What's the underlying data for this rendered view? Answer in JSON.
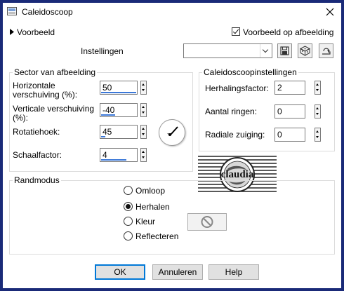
{
  "window": {
    "title": "Caleidoscoop"
  },
  "preview": {
    "label": "Voorbeeld",
    "checkbox_label": "Voorbeeld op afbeelding",
    "checked": true
  },
  "settings": {
    "label": "Instellingen",
    "value": ""
  },
  "sector": {
    "group_title": "Sector van afbeelding",
    "h_shift_label": "Horizontale verschuiving (%):",
    "h_shift_value": "50",
    "v_shift_label": "Verticale verschuiving (%):",
    "v_shift_value": "-40",
    "rotation_label": "Rotatiehoek:",
    "rotation_value": "45",
    "scale_label": "Schaalfactor:",
    "scale_value": "4"
  },
  "kaleido": {
    "group_title": "Caleidoscoopinstellingen",
    "repeat_label": "Herhalingsfactor:",
    "repeat_value": "2",
    "rings_label": "Aantal ringen:",
    "rings_value": "0",
    "radial_label": "Radiale zuiging:",
    "radial_value": "0"
  },
  "edge": {
    "group_title": "Randmodus",
    "options": [
      "Omloop",
      "Herhalen",
      "Kleur",
      "Reflecteren"
    ],
    "selected": "Herhalen"
  },
  "buttons": {
    "ok": "OK",
    "cancel": "Annuleren",
    "help": "Help"
  },
  "watermark": {
    "text": "claudia"
  },
  "colors": {
    "desktop": "#1a2a78",
    "accent": "#0078d7",
    "slider_bar": "#3c78d8"
  }
}
